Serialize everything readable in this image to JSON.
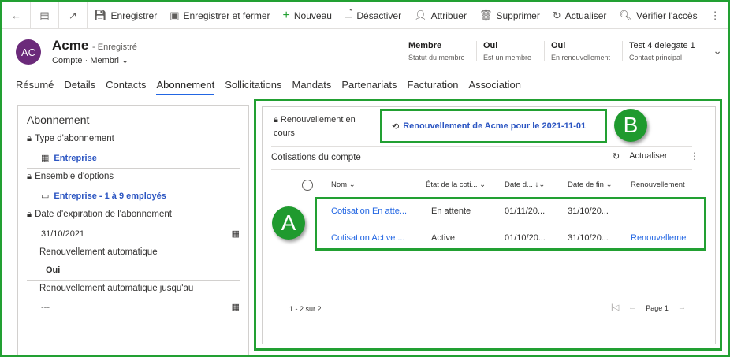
{
  "toolbar": {
    "items": [
      {
        "label": "",
        "icon": "back-arrow-icon"
      },
      {
        "label": "",
        "icon": "form-icon"
      },
      {
        "label": "",
        "icon": "open-new-window-icon"
      },
      {
        "label": "Enregistrer",
        "icon": "save-icon"
      },
      {
        "label": "Enregistrer et fermer",
        "icon": "save-close-icon"
      },
      {
        "label": "Nouveau",
        "icon": "plus-icon"
      },
      {
        "label": "Désactiver",
        "icon": "deactivate-icon"
      },
      {
        "label": "Attribuer",
        "icon": "assign-icon"
      },
      {
        "label": "Supprimer",
        "icon": "trash-icon"
      },
      {
        "label": "Actualiser",
        "icon": "refresh-icon"
      },
      {
        "label": "Vérifier l'accès",
        "icon": "check-access-icon"
      },
      {
        "label": "⋮",
        "icon": "more-icon"
      }
    ]
  },
  "header": {
    "initials": "AC",
    "avatar_color": "#6b2a7a",
    "title": "Acme",
    "status": "- Enregistré",
    "entity": "Compte",
    "form": "Membri",
    "fields": [
      {
        "value": "Membre",
        "label": "Statut du membre"
      },
      {
        "value": "Oui",
        "label": "Est un membre"
      },
      {
        "value": "Oui",
        "label": "En renouvellement"
      },
      {
        "value": "Test 4 delegate 1",
        "label": "Contact principal"
      }
    ]
  },
  "tabs": [
    "Résumé",
    "Details",
    "Contacts",
    "Abonnement",
    "Sollicitations",
    "Mandats",
    "Partenariats",
    "Facturation",
    "Association"
  ],
  "active_tab": "Abonnement",
  "left": {
    "title": "Abonnement",
    "fields": [
      {
        "label": "Type d'abonnement",
        "value": "Entreprise",
        "locked": true
      },
      {
        "label": "Ensemble d'options",
        "value": "Entreprise - 1 à 9 employés",
        "locked": true
      },
      {
        "label": "Date d'expiration de l'abonnement",
        "value": "31/10/2021",
        "locked": true
      },
      {
        "label": "Renouvellement automatique",
        "value": "Oui",
        "locked": false
      },
      {
        "label": "Renouvellement automatique jusqu'au",
        "value": "---",
        "locked": false
      }
    ]
  },
  "right": {
    "renewal_label": "Renouvellement en cours",
    "renewal_link": "Renouvellement de Acme pour le 2021-11-01",
    "grid_title": "Cotisations du compte",
    "refresh": "Actualiser",
    "columns": [
      "Nom",
      "État de la coti...",
      "Date d...",
      "Date de fin",
      "Renouvellement"
    ],
    "rows": [
      [
        "Cotisation En atte...",
        "En attente",
        "01/11/20...",
        "31/10/20...",
        ""
      ],
      [
        "Cotisation Active ...",
        "Active",
        "01/10/20...",
        "31/10/20...",
        "Renouvelleme"
      ]
    ],
    "count": "1 - 2 sur 2",
    "page": "Page 1"
  },
  "callouts": {
    "a": "A",
    "b": "B",
    "color": "#22a032"
  }
}
